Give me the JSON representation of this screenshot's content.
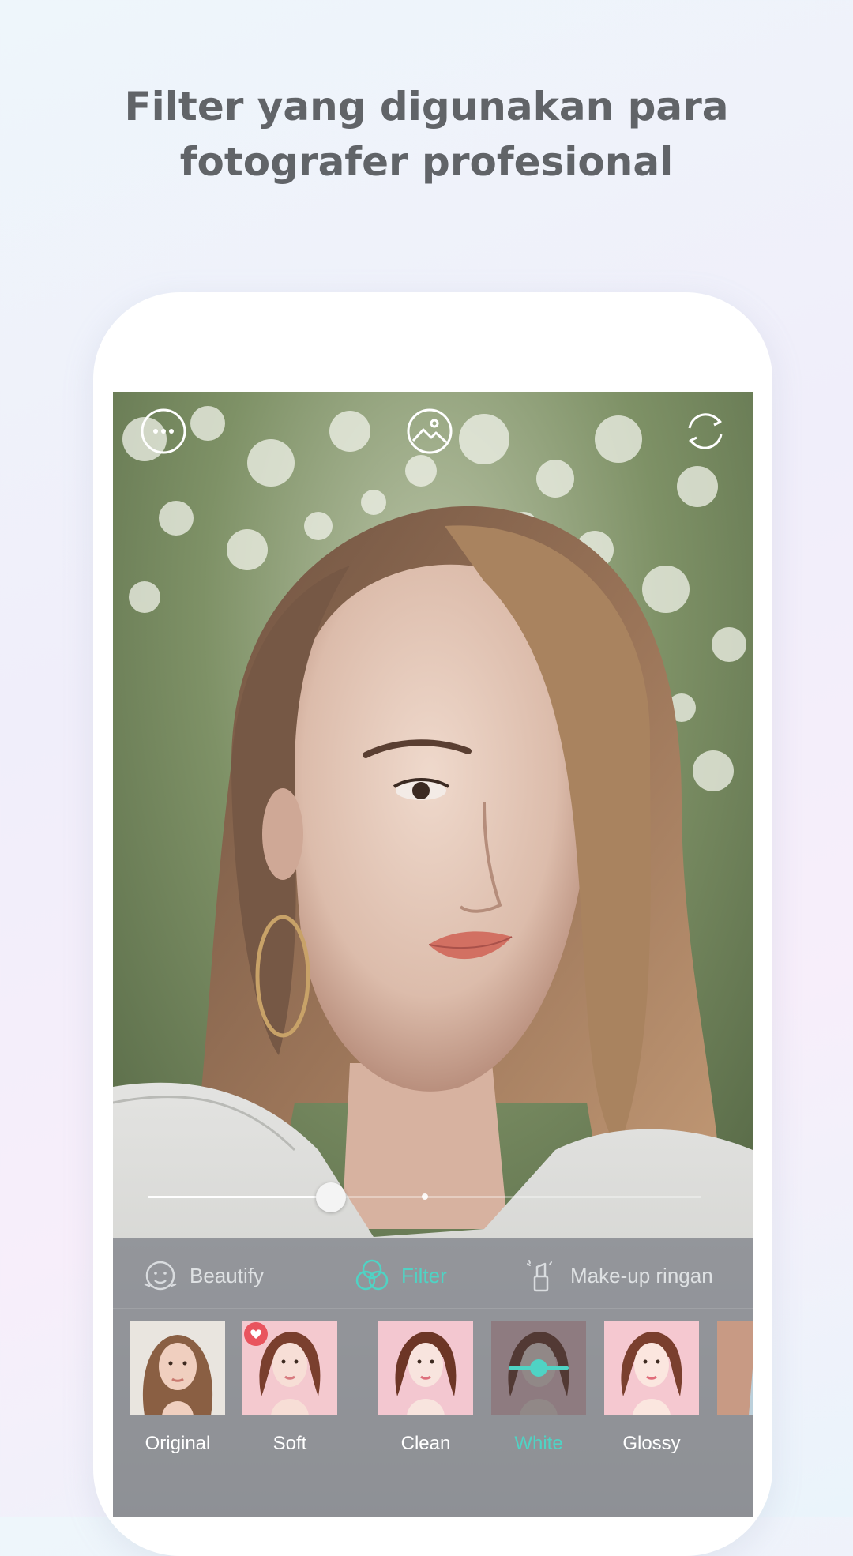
{
  "headline": {
    "line1": "Filter yang digunakan para",
    "line2": "fotografer profesional"
  },
  "topbar": {
    "icons": [
      "more-icon",
      "gallery-icon",
      "switch-camera-icon"
    ]
  },
  "slider": {
    "value_percent": 33,
    "default_mark_percent": 50
  },
  "tabs": [
    {
      "label": "Beautify",
      "icon": "face-icon",
      "active": false
    },
    {
      "label": "Filter",
      "icon": "filter-icon",
      "active": true
    },
    {
      "label": "Make-up ringan",
      "icon": "lipstick-icon",
      "active": false
    }
  ],
  "filters": [
    {
      "label": "Original",
      "selected": false,
      "favorite": false
    },
    {
      "label": "Soft",
      "selected": false,
      "favorite": true
    },
    {
      "label": "Clean",
      "selected": false,
      "favorite": false
    },
    {
      "label": "White",
      "selected": true,
      "favorite": false
    },
    {
      "label": "Glossy",
      "selected": false,
      "favorite": false
    }
  ],
  "colors": {
    "accent": "#4fd3c4",
    "headline": "#616468",
    "favorite": "#e9545e"
  }
}
